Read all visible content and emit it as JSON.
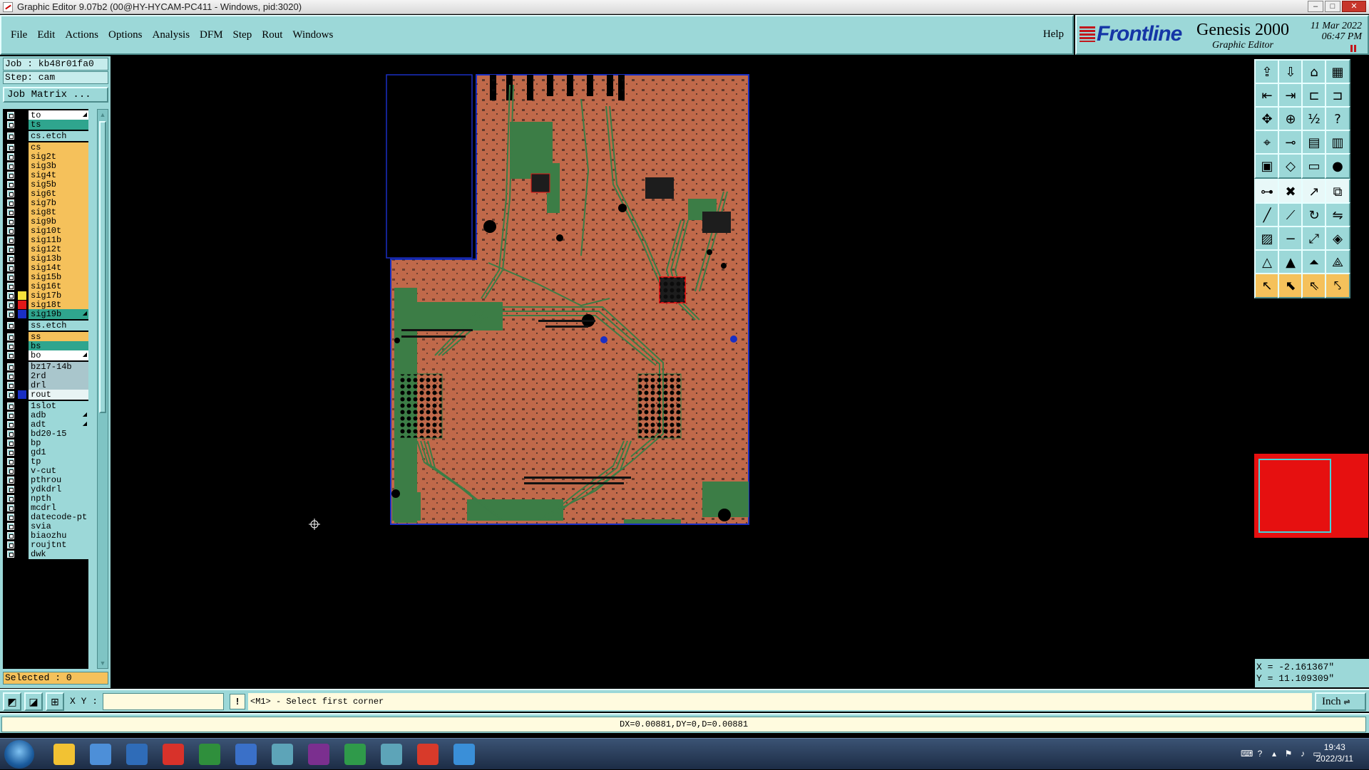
{
  "window": {
    "title": "Graphic Editor 9.07b2 (00@HY-HYCAM-PC411 - Windows, pid:3020)",
    "controls": [
      "–",
      "□",
      "✕"
    ]
  },
  "menu": [
    "File",
    "Edit",
    "Actions",
    "Options",
    "Analysis",
    "DFM",
    "Step",
    "Rout",
    "Windows"
  ],
  "help": "Help",
  "brand": {
    "logo": "Frontline",
    "product": "Genesis 2000",
    "subtitle": "Graphic Editor",
    "date": "11 Mar 2022",
    "time": "06:47 PM"
  },
  "job": {
    "job_line": "Job : kb48r01fa0",
    "step_line": "Step: cam",
    "matrix_button": "Job Matrix ..."
  },
  "layers": [
    {
      "name": "to",
      "color": "#ffffff",
      "swatch": "#000000",
      "arrow": true
    },
    {
      "name": "ts",
      "color": "#2fa58e",
      "swatch": "#000000"
    },
    {
      "name": "cs.etch",
      "color": "#9cd8d8",
      "swatch": "#000000",
      "header": true
    },
    {
      "name": "cs",
      "color": "#f5c15b",
      "swatch": "#000000"
    },
    {
      "name": "sig2t",
      "color": "#f5c15b",
      "swatch": "#000000"
    },
    {
      "name": "sig3b",
      "color": "#f5c15b",
      "swatch": "#000000"
    },
    {
      "name": "sig4t",
      "color": "#f5c15b",
      "swatch": "#000000"
    },
    {
      "name": "sig5b",
      "color": "#f5c15b",
      "swatch": "#000000"
    },
    {
      "name": "sig6t",
      "color": "#f5c15b",
      "swatch": "#000000"
    },
    {
      "name": "sig7b",
      "color": "#f5c15b",
      "swatch": "#000000"
    },
    {
      "name": "sig8t",
      "color": "#f5c15b",
      "swatch": "#000000"
    },
    {
      "name": "sig9b",
      "color": "#f5c15b",
      "swatch": "#000000"
    },
    {
      "name": "sig10t",
      "color": "#f5c15b",
      "swatch": "#000000"
    },
    {
      "name": "sig11b",
      "color": "#f5c15b",
      "swatch": "#000000"
    },
    {
      "name": "sig12t",
      "color": "#f5c15b",
      "swatch": "#000000"
    },
    {
      "name": "sig13b",
      "color": "#f5c15b",
      "swatch": "#000000"
    },
    {
      "name": "sig14t",
      "color": "#f5c15b",
      "swatch": "#000000"
    },
    {
      "name": "sig15b",
      "color": "#f5c15b",
      "swatch": "#000000"
    },
    {
      "name": "sig16t",
      "color": "#f5c15b",
      "swatch": "#000000"
    },
    {
      "name": "sig17b",
      "color": "#f5c15b",
      "swatch": "#f6e23b"
    },
    {
      "name": "sig18t",
      "color": "#f5c15b",
      "swatch": "#e01818"
    },
    {
      "name": "sig19b",
      "color": "#2fa58e",
      "swatch": "#1a2fc4",
      "arrow": true
    },
    {
      "name": "ss.etch",
      "color": "#9cd8d8",
      "swatch": "#000000",
      "header": true
    },
    {
      "name": "ss",
      "color": "#f5c15b",
      "swatch": "#000000"
    },
    {
      "name": "bs",
      "color": "#2fa58e",
      "swatch": "#000000"
    },
    {
      "name": "bo",
      "color": "#ffffff",
      "swatch": "#000000",
      "arrow": true
    },
    {
      "name": "bz17-14b",
      "color": "#a9c6cc",
      "swatch": "#000000",
      "gap": true
    },
    {
      "name": "2rd",
      "color": "#a9c6cc",
      "swatch": "#000000"
    },
    {
      "name": "drl",
      "color": "#a9c6cc",
      "swatch": "#000000"
    },
    {
      "name": "rout",
      "color": "#e8f4f4",
      "swatch": "#1a2fc4"
    },
    {
      "name": "1slot",
      "color": "#9cd8d8",
      "swatch": "#000000",
      "gap": true
    },
    {
      "name": "adb",
      "color": "#9cd8d8",
      "swatch": "#000000",
      "arrow": true
    },
    {
      "name": "adt",
      "color": "#9cd8d8",
      "swatch": "#000000",
      "arrow": true
    },
    {
      "name": "bd20-15",
      "color": "#9cd8d8",
      "swatch": "#000000"
    },
    {
      "name": "bp",
      "color": "#9cd8d8",
      "swatch": "#000000"
    },
    {
      "name": "gd1",
      "color": "#9cd8d8",
      "swatch": "#000000"
    },
    {
      "name": "tp",
      "color": "#9cd8d8",
      "swatch": "#000000"
    },
    {
      "name": "v-cut",
      "color": "#9cd8d8",
      "swatch": "#000000"
    },
    {
      "name": "pthrou",
      "color": "#9cd8d8",
      "swatch": "#000000"
    },
    {
      "name": "ydkdrl",
      "color": "#9cd8d8",
      "swatch": "#000000"
    },
    {
      "name": "npth",
      "color": "#9cd8d8",
      "swatch": "#000000"
    },
    {
      "name": "mcdrl",
      "color": "#9cd8d8",
      "swatch": "#000000"
    },
    {
      "name": "datecode-pt",
      "color": "#9cd8d8",
      "swatch": "#000000"
    },
    {
      "name": "svia",
      "color": "#9cd8d8",
      "swatch": "#000000"
    },
    {
      "name": "biaozhu",
      "color": "#9cd8d8",
      "swatch": "#000000"
    },
    {
      "name": "roujtnt",
      "color": "#9cd8d8",
      "swatch": "#000000"
    },
    {
      "name": "dwk",
      "color": "#9cd8d8",
      "swatch": "#000000"
    }
  ],
  "selected": "Selected : 0",
  "toolbar_icons": [
    "open-job-icon",
    "save-icon",
    "home-icon",
    "window-layout-icon",
    "import-icon",
    "export-icon",
    "snap-icon",
    "split-icon",
    "fit-icon",
    "zoom-center-icon",
    "scale-1-2-icon",
    "help-icon",
    "measure-icon",
    "probe-icon",
    "layer-select-icon",
    "layer-compare-icon",
    "pad-icon",
    "shape-icon",
    "ruler-icon",
    "dot-icon",
    "connect-icon",
    "delete-feature-icon",
    "move-icon",
    "copy-icon",
    "line-icon",
    "arc-line-icon",
    "rotate-icon",
    "mirror-icon",
    "fill-icon",
    "minus-icon",
    "resize-icon",
    "surface-icon",
    "triangle-icon",
    "triangle-alt-icon",
    "triangle-cut-icon",
    "triangle-cut-alt-icon",
    "pointer-icon",
    "select-icon",
    "select-alt-icon",
    "route-icon"
  ],
  "coords": {
    "x": "X = -2.161367\"",
    "y": "Y = 11.109309\""
  },
  "command": {
    "xy_label": "X Y :",
    "xy_value": "",
    "message_icon": "!",
    "message": "<M1> - Select first corner",
    "unit": "Inch"
  },
  "status": "DX=0.00881,DY=0,D=0.00881",
  "tray": {
    "time": "19:43",
    "date": "2022/3/11"
  },
  "taskbar_apps": [
    "start-button",
    "shell-icon",
    "notepad-icon",
    "save-disk-icon",
    "graphics-g-icon",
    "publisher-icon",
    "word-icon",
    "genesis-eye-icon",
    "genesis-x-icon",
    "excel-icon",
    "genesis-eye2-icon",
    "pdf-icon",
    "remote-icon"
  ],
  "colors": {
    "panel": "#9cd8d8",
    "board": "#c0694a",
    "copper_green": "#3c7d46",
    "outline": "#1a2fc4",
    "highlight": "#f5c15b"
  }
}
